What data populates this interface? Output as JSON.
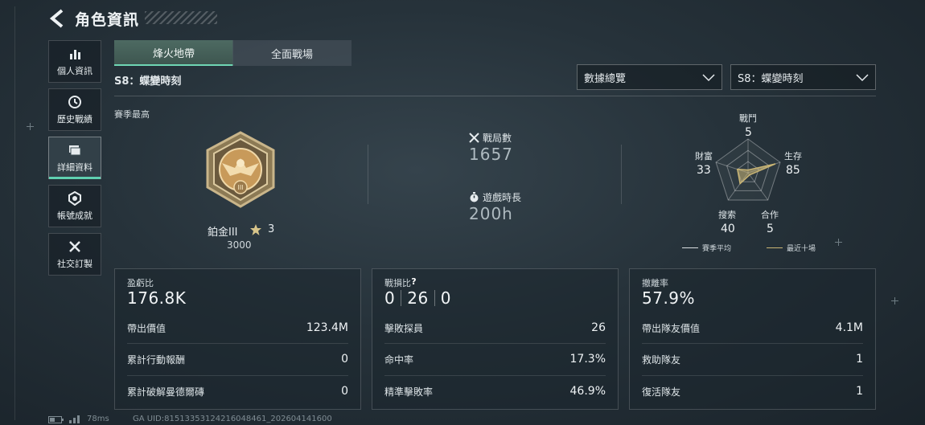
{
  "header": {
    "title": "角色資訊"
  },
  "sidebar": {
    "items": [
      {
        "label": "個人資訊",
        "icon": "bar-chart-icon",
        "active": false
      },
      {
        "label": "歷史戰績",
        "icon": "clock-history-icon",
        "active": false
      },
      {
        "label": "詳細資料",
        "icon": "folder-icon",
        "active": true
      },
      {
        "label": "帳號成就",
        "icon": "medal-icon",
        "active": false
      },
      {
        "label": "社交訂製",
        "icon": "tools-icon",
        "active": false
      }
    ]
  },
  "tabs": [
    {
      "label": "烽火地帶",
      "active": true
    },
    {
      "label": "全面戰場",
      "active": false
    }
  ],
  "season_label": "S8：蝶變時刻",
  "dropdowns": {
    "view": {
      "value": "數據總覽"
    },
    "season": {
      "value": "S8：蝶變時刻"
    }
  },
  "season_high": {
    "label": "賽季最高",
    "rank_name": "鉑金III",
    "stars": "3",
    "points": "3000"
  },
  "summary": {
    "matches": {
      "label": "戰局數",
      "value": "1657"
    },
    "playtime": {
      "label": "遊戲時長",
      "value": "200h"
    }
  },
  "radar": {
    "axes": [
      {
        "label": "戰鬥",
        "value": "5"
      },
      {
        "label": "生存",
        "value": "85"
      },
      {
        "label": "合作",
        "value": "5"
      },
      {
        "label": "搜索",
        "value": "40"
      },
      {
        "label": "財富",
        "value": "33"
      }
    ],
    "legend": {
      "season_avg": "賽季平均",
      "recent": "最近十場"
    },
    "colors": {
      "recent": "#c9b574",
      "season_avg": "#d9dde0"
    }
  },
  "cards": {
    "profit": {
      "label": "盈虧比",
      "value": "176.8K",
      "rows": [
        {
          "label": "帶出價值",
          "value": "123.4M"
        },
        {
          "label": "累計行動報酬",
          "value": "0"
        },
        {
          "label": "累計破解曼德爾磚",
          "value": "0"
        }
      ]
    },
    "kd": {
      "label": "戰損比",
      "help": "?",
      "k": "0",
      "d": "26",
      "a": "0",
      "rows": [
        {
          "label": "擊敗探員",
          "value": "26"
        },
        {
          "label": "命中率",
          "value": "17.3%"
        },
        {
          "label": "精準擊敗率",
          "value": "46.9%"
        }
      ]
    },
    "extract": {
      "label": "撤離率",
      "value": "57.9%",
      "rows": [
        {
          "label": "帶出隊友價值",
          "value": "4.1M"
        },
        {
          "label": "救助隊友",
          "value": "1"
        },
        {
          "label": "復活隊友",
          "value": "1"
        }
      ]
    }
  },
  "footer": {
    "ping": "78ms",
    "uid": "GA UID:8151335312421604846​1_202604141600"
  },
  "accent": "#6fd6b4"
}
